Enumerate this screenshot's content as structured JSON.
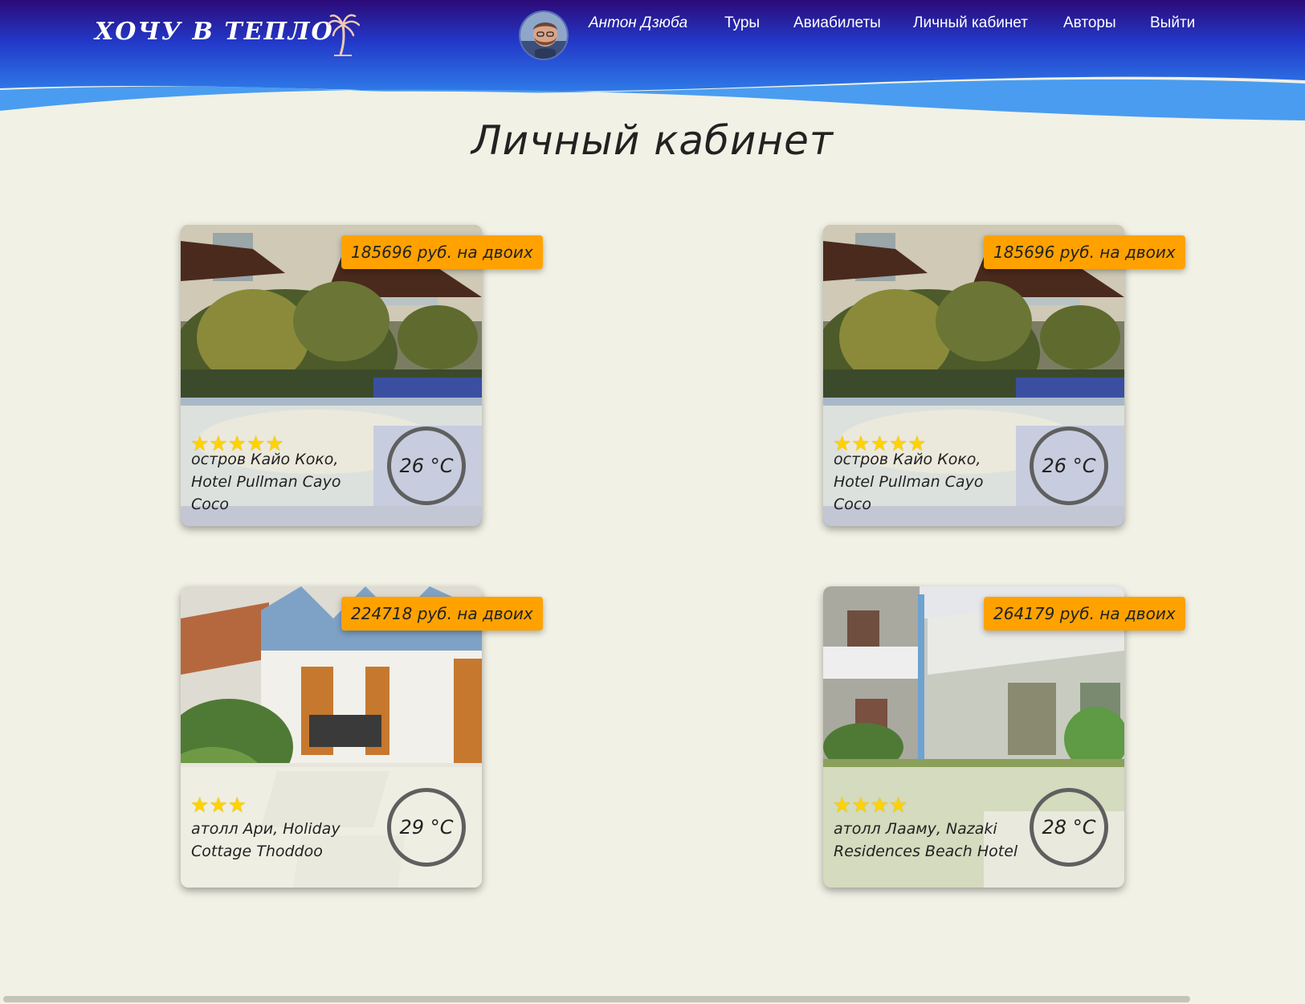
{
  "header": {
    "logo_text": "ХОЧУ В ТЕПЛО",
    "user_name": "Антон Дзюба",
    "nav": [
      "Туры",
      "Авиабилеты",
      "Личный кабинет",
      "Авторы",
      "Выйти"
    ],
    "colors": {
      "top": "#2a0a7a",
      "mid": "#1c3fd0",
      "wave": "#4aa0f0"
    }
  },
  "page": {
    "title": "Личный кабинет"
  },
  "cards": [
    {
      "price": "185696 руб. на двоих",
      "stars": "★★★★★",
      "rating": 5,
      "name": "остров Кайо Коко, Hotel Pullman Cayo Coco",
      "temp": "26 °C",
      "photo": "resort-pool-icon"
    },
    {
      "price": "185696 руб. на двоих",
      "stars": "★★★★★",
      "rating": 5,
      "name": "остров Кайо Коко, Hotel Pullman Cayo Coco",
      "temp": "26 °C",
      "photo": "resort-pool-icon"
    },
    {
      "price": "224718 руб. на двоих",
      "stars": "★★★",
      "rating": 3,
      "name": "атолл Ари, Holiday Cottage Thoddoo",
      "temp": "29 °C",
      "photo": "beach-cottage-icon"
    },
    {
      "price": "264179 руб. на двоих",
      "stars": "★★★★",
      "rating": 4,
      "name": "атолл Лааму, Nazaki Residences Beach Hotel",
      "temp": "28 °C",
      "photo": "residence-building-icon"
    }
  ]
}
